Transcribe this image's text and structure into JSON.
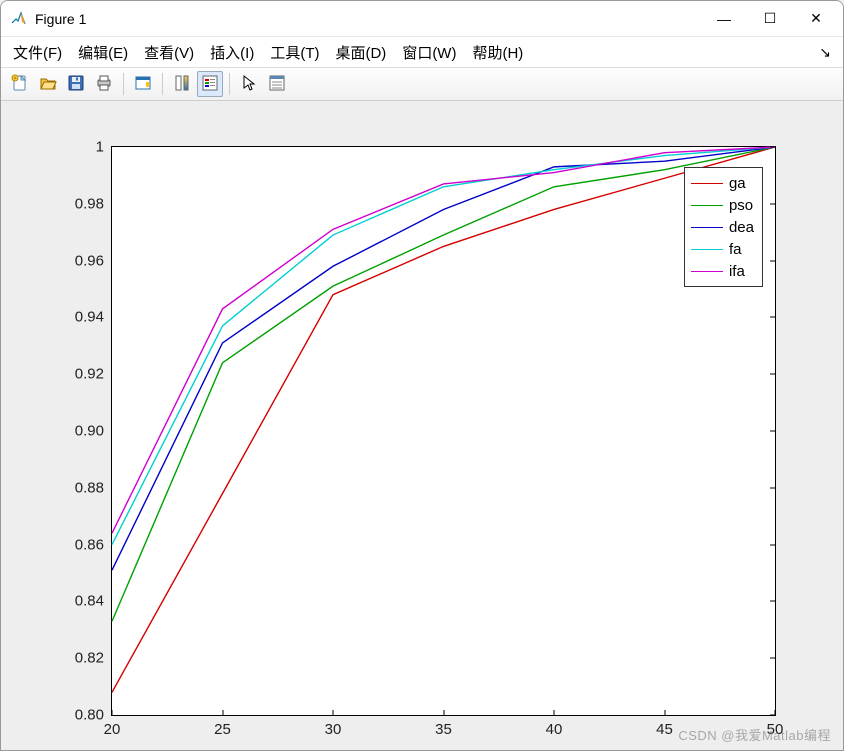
{
  "window": {
    "title": "Figure 1",
    "minimize": "—",
    "maximize": "☐",
    "close": "✕"
  },
  "menubar": {
    "items": [
      "文件(F)",
      "编辑(E)",
      "查看(V)",
      "插入(I)",
      "工具(T)",
      "桌面(D)",
      "窗口(W)",
      "帮助(H)"
    ],
    "arrow": "↘"
  },
  "toolbar": {
    "items": [
      {
        "name": "new-figure",
        "active": false
      },
      {
        "name": "open-file",
        "active": false
      },
      {
        "name": "save",
        "active": false
      },
      {
        "name": "print",
        "active": false
      },
      {
        "name": "sep"
      },
      {
        "name": "link-axes",
        "active": false
      },
      {
        "name": "sep"
      },
      {
        "name": "insert-colorbar",
        "active": false
      },
      {
        "name": "insert-legend",
        "active": true
      },
      {
        "name": "sep"
      },
      {
        "name": "edit-plot-arrow",
        "active": false
      },
      {
        "name": "open-property-inspector",
        "active": false
      }
    ]
  },
  "legend": {
    "entries": [
      "ga",
      "pso",
      "dea",
      "fa",
      "ifa"
    ]
  },
  "colors": {
    "ga": "#d40000",
    "pso": "#00a000",
    "dea": "#0000c8",
    "fa": "#00d0d0",
    "ifa": "#d000d0"
  },
  "ticks": {
    "x": [
      20,
      25,
      30,
      35,
      40,
      45,
      50
    ],
    "y": [
      0.8,
      0.82,
      0.84,
      0.86,
      0.88,
      0.9,
      0.92,
      0.94,
      0.96,
      0.98,
      1.0
    ]
  },
  "chart_data": {
    "type": "line",
    "title": "",
    "xlabel": "",
    "ylabel": "",
    "xlim": [
      20,
      50
    ],
    "ylim": [
      0.8,
      1.0
    ],
    "x": [
      20,
      25,
      30,
      35,
      40,
      45,
      50
    ],
    "series": [
      {
        "name": "ga",
        "values": [
          0.808,
          0.878,
          0.948,
          0.965,
          0.978,
          0.989,
          1.0
        ]
      },
      {
        "name": "pso",
        "values": [
          0.833,
          0.924,
          0.951,
          0.969,
          0.986,
          0.992,
          1.0
        ]
      },
      {
        "name": "dea",
        "values": [
          0.851,
          0.931,
          0.958,
          0.978,
          0.993,
          0.995,
          1.0
        ]
      },
      {
        "name": "fa",
        "values": [
          0.86,
          0.937,
          0.969,
          0.986,
          0.992,
          0.997,
          1.0
        ]
      },
      {
        "name": "ifa",
        "values": [
          0.864,
          0.943,
          0.971,
          0.987,
          0.991,
          0.998,
          1.0
        ]
      }
    ]
  },
  "watermark": "CSDN @我爱Matlab编程"
}
